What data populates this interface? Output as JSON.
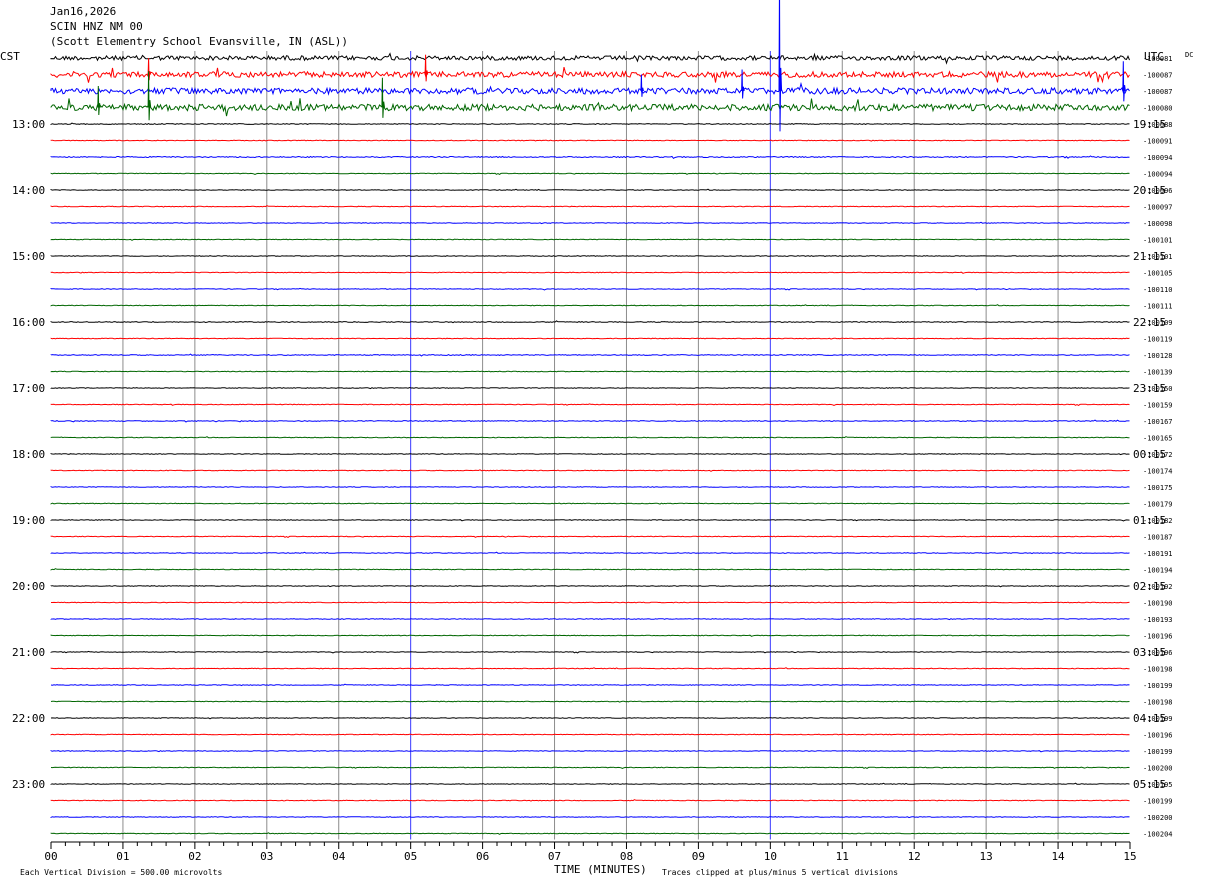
{
  "header": {
    "date": "Jan16,2026",
    "station": "SCIN HNZ NM 00",
    "location": "(Scott Elementry School Evansville, IN (ASL))"
  },
  "left_timezone": "CST",
  "right_timezone": "UTC",
  "dc_label": "DC",
  "colors": {
    "trace_cycle": [
      "#000000",
      "#ff0000",
      "#0000ff",
      "#006600"
    ],
    "minute_gridline": "#8c8c8c",
    "quarter_gridline": "#3838ff"
  },
  "chart_data": {
    "type": "line",
    "description_type": "helicorder",
    "x_range": [
      0,
      15
    ],
    "x_ticks": [
      "00",
      "01",
      "02",
      "03",
      "04",
      "05",
      "06",
      "07",
      "08",
      "09",
      "10",
      "11",
      "12",
      "13",
      "14",
      "15"
    ],
    "xlabel": "TIME (MINUTES)",
    "left_hour_labels": [
      "13:00",
      "14:00",
      "15:00",
      "16:00",
      "17:00",
      "18:00",
      "19:00",
      "20:00",
      "21:00",
      "22:00",
      "23:00"
    ],
    "right_hour_labels": [
      "19:15",
      "20:15",
      "21:15",
      "22:15",
      "23:15",
      "00:15",
      "01:15",
      "02:15",
      "03:15",
      "04:15",
      "05:15"
    ],
    "trace_dc_offsets": [
      "-100081",
      "-100087",
      "-100087",
      "-100080",
      "-100088",
      "-100091",
      "-100094",
      "-100094",
      "-100096",
      "-100097",
      "-100098",
      "-100101",
      "-100101",
      "-100105",
      "-100110",
      "-100111",
      "-100109",
      "-100119",
      "-100128",
      "-100139",
      "-100150",
      "-100159",
      "-100167",
      "-100165",
      "-100172",
      "-100174",
      "-100175",
      "-100179",
      "-100182",
      "-100187",
      "-100191",
      "-100194",
      "-100192",
      "-100190",
      "-100193",
      "-100196",
      "-100196",
      "-100198",
      "-100199",
      "-100198",
      "-100199",
      "-100196",
      "-100199",
      "-100200",
      "-100195",
      "-100199",
      "-100200",
      "-100204"
    ],
    "trace_activity": [
      2.2,
      2.8,
      3.0,
      3.2,
      0.4,
      0.3,
      0.5,
      0.3,
      0.3,
      0.3,
      0.3,
      0.3,
      0.3,
      0.3,
      0.3,
      0.3,
      0.4,
      0.3,
      0.4,
      0.3,
      0.3,
      0.3,
      0.4,
      0.3,
      0.3,
      0.3,
      0.3,
      0.3,
      0.3,
      0.3,
      0.3,
      0.3,
      0.3,
      0.3,
      0.3,
      0.3,
      0.3,
      0.3,
      0.3,
      0.3,
      0.3,
      0.3,
      0.3,
      0.3,
      0.3,
      0.3,
      0.3,
      0.3
    ],
    "events": [
      {
        "trace": 2,
        "minute": 10.12,
        "amplitude": 7.0
      },
      {
        "trace": 1,
        "minute": 5.2,
        "amplitude": 1.2
      },
      {
        "trace": 1,
        "minute": 1.35,
        "amplitude": 1.0
      },
      {
        "trace": 3,
        "minute": 1.35,
        "amplitude": 2.2
      },
      {
        "trace": 3,
        "minute": 4.6,
        "amplitude": 1.8
      },
      {
        "trace": 3,
        "minute": 0.65,
        "amplitude": 1.3
      },
      {
        "trace": 2,
        "minute": 9.6,
        "amplitude": 1.3
      },
      {
        "trace": 2,
        "minute": 14.9,
        "amplitude": 1.8
      },
      {
        "trace": 2,
        "minute": 8.2,
        "amplitude": 1.0
      }
    ]
  },
  "footer": {
    "scale_note": "Each Vertical Division =  500.00 microvolts",
    "clip_note": "Traces clipped at plus/minus 5 vertical divisions"
  }
}
